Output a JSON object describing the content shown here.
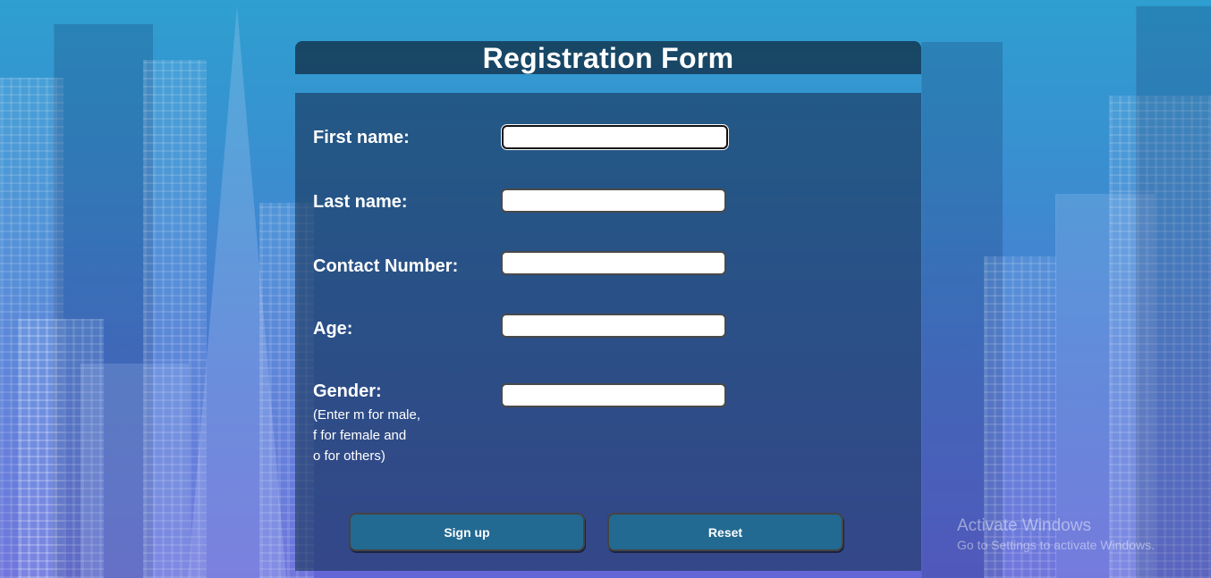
{
  "form": {
    "title": "Registration Form",
    "fields": {
      "first_name": {
        "label": "First name:",
        "value": ""
      },
      "last_name": {
        "label": "Last name:",
        "value": ""
      },
      "contact_number": {
        "label": "Contact Number:",
        "value": ""
      },
      "age": {
        "label": "Age:",
        "value": ""
      },
      "gender": {
        "label": "Gender:",
        "hint_lines": [
          "(Enter m for male,",
          "f for female and",
          "o for others)"
        ],
        "value": ""
      }
    },
    "buttons": {
      "signup": "Sign up",
      "reset": "Reset"
    }
  },
  "watermark": {
    "title": "Activate Windows",
    "subtitle": "Go to Settings to activate Windows."
  }
}
